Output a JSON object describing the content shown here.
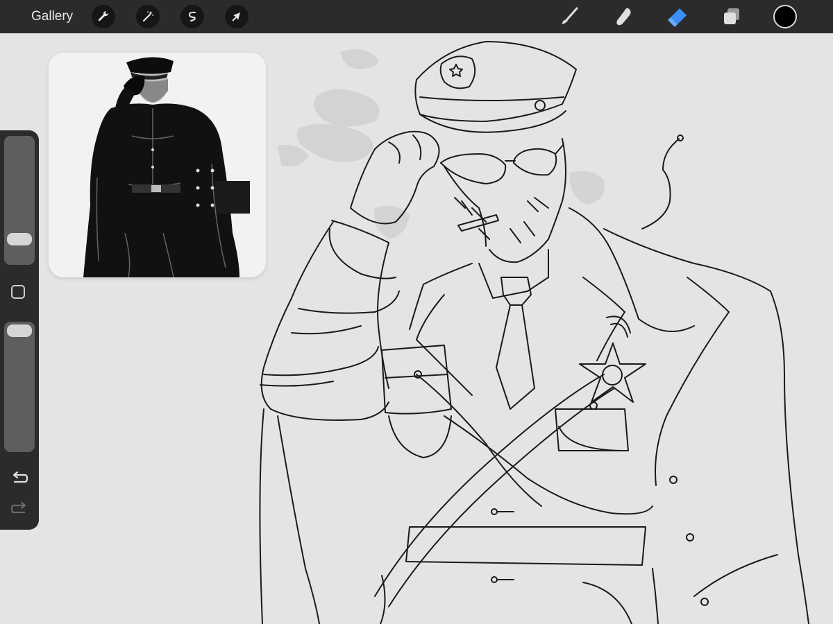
{
  "app": {
    "gallery_label": "Gallery"
  },
  "toolbar": {
    "left_tools": [
      "actions-icon",
      "adjustments-icon",
      "selection-icon",
      "transform-icon"
    ],
    "right_tools": [
      "brush-icon",
      "smudge-icon",
      "eraser-icon",
      "layers-icon"
    ],
    "active_tool": "eraser",
    "active_color": "#000000"
  },
  "sidebar": {
    "brush_size": 0.15,
    "opacity": 1.0
  },
  "colors": {
    "toolbar_bg": "#2b2b2b",
    "canvas_bg": "#e4e4e4",
    "accent_blue": "#3a8ef6",
    "ink": "#1a1a1a"
  },
  "reference": {
    "visible": true
  }
}
